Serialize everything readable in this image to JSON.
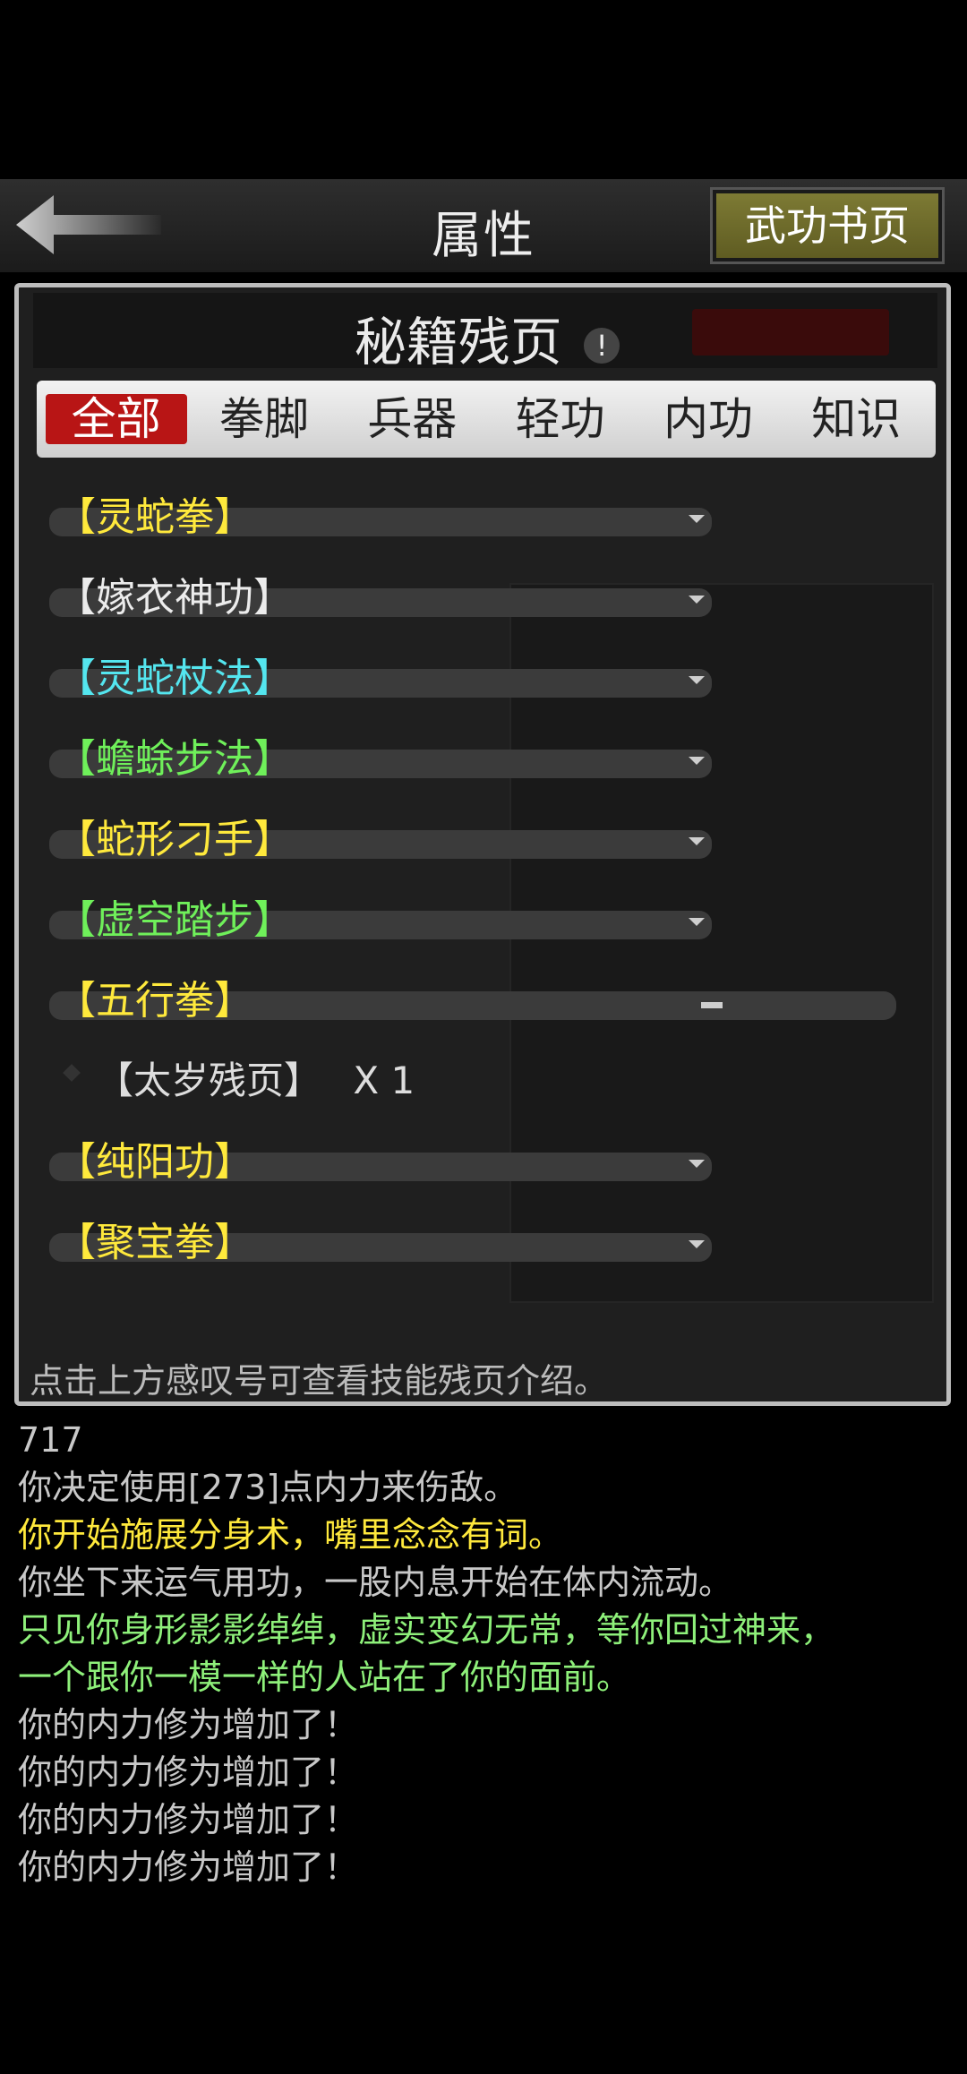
{
  "header": {
    "title": "属性",
    "right_button": "武功书页"
  },
  "panel": {
    "subtitle": "秘籍残页",
    "info_mark": "!",
    "filters": [
      "全部",
      "拳脚",
      "兵器",
      "轻功",
      "内功",
      "知识"
    ],
    "active_filter": "全部",
    "items": [
      {
        "label": "【灵蛇拳】",
        "color": "#ffe93c"
      },
      {
        "label": "【嫁衣神功】",
        "color": "#ececec"
      },
      {
        "label": "【灵蛇杖法】",
        "color": "#54e6ef"
      },
      {
        "label": "【蟾蜍步法】",
        "color": "#6ff05a"
      },
      {
        "label": "【蛇形刁手】",
        "color": "#ffe93c"
      },
      {
        "label": "【虚空踏步】",
        "color": "#6ff05a"
      },
      {
        "label": "【五行拳】",
        "color": "#ffe93c",
        "expanded": true
      },
      {
        "label": "【纯阳功】",
        "color": "#ffe93c"
      },
      {
        "label": "【聚宝拳】",
        "color": "#ffe93c"
      }
    ],
    "expanded_sub": {
      "name": "【太岁残页】",
      "count": "X 1"
    },
    "hint": "点击上方感叹号可查看技能残页介绍。"
  },
  "log": [
    {
      "text": "717",
      "color": "#c8c8c8"
    },
    {
      "text": "你决定使用[273]点内力来伤敌。",
      "color": "#c8c8c8"
    },
    {
      "text": "你开始施展分身术，嘴里念念有词。",
      "color": "#ffe93c"
    },
    {
      "text": "你坐下来运气用功，一股内息开始在体内流动。",
      "color": "#c8c8c8"
    },
    {
      "text": "只见你身形影影绰绰，虚实变幻无常，等你回过神来，",
      "color": "#8ef07a"
    },
    {
      "text": "一个跟你一模一样的人站在了你的面前。",
      "color": "#8ef07a"
    },
    {
      "text": "你的内力修为增加了！",
      "color": "#c8c8c8"
    },
    {
      "text": "你的内力修为增加了！",
      "color": "#c8c8c8"
    },
    {
      "text": "你的内力修为增加了！",
      "color": "#c8c8c8"
    },
    {
      "text": "你的内力修为增加了！",
      "color": "#c8c8c8"
    }
  ]
}
